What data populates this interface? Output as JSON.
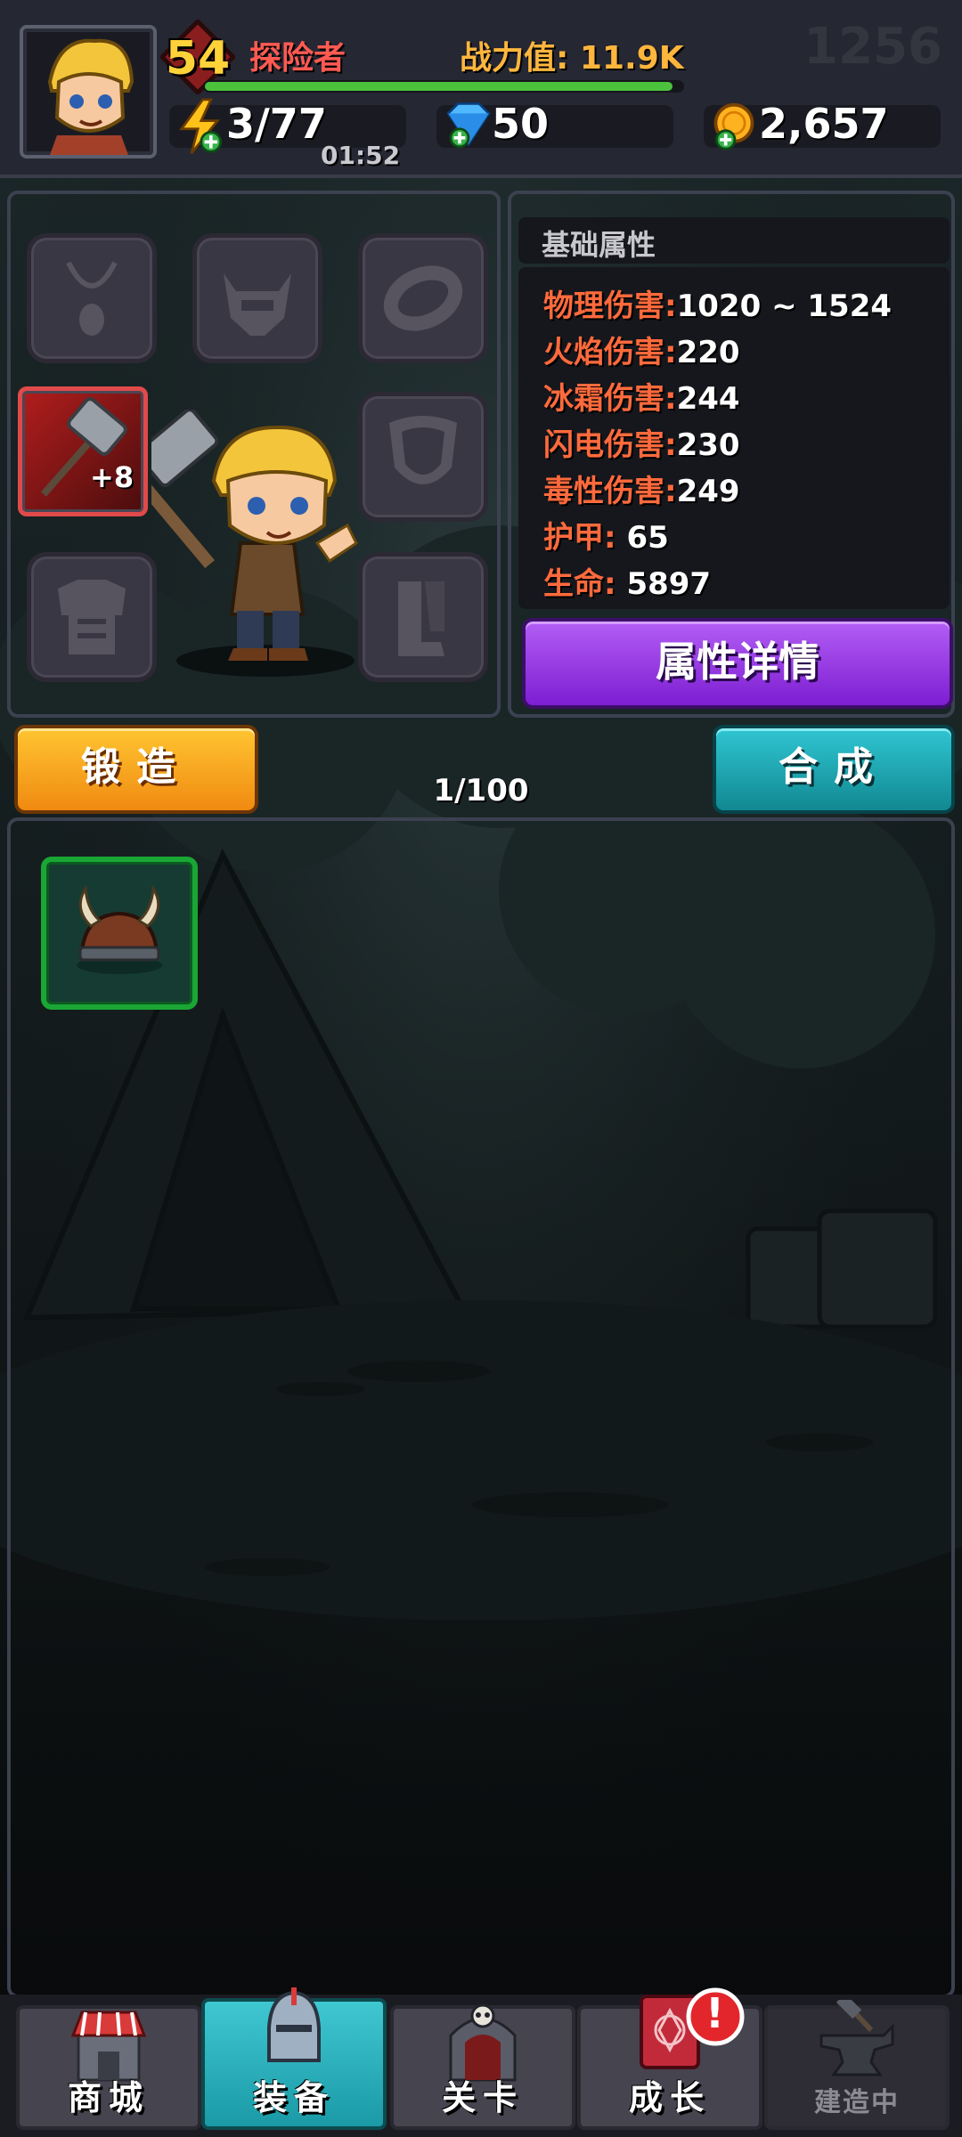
{
  "player": {
    "level": "54",
    "name": "探险者",
    "power_label": "战力值: 11.9K",
    "xp_fraction": 0.98
  },
  "resources": {
    "energy": "3/77",
    "energy_timer": "01:52",
    "gems": "50",
    "coins": "2,657"
  },
  "faded_number": "1256",
  "equipment": {
    "weapon_level": "+8",
    "slots": [
      "necklace-slot",
      "helmet-slot",
      "ring-slot",
      "weapon-slot",
      "shield-slot",
      "armor-slot",
      "boots-slot"
    ]
  },
  "stats": {
    "header": "基础属性",
    "rows": [
      {
        "label": "物理伤害:",
        "value": "1020 ~ 1524"
      },
      {
        "label": "火焰伤害:",
        "value": "220"
      },
      {
        "label": "冰霜伤害:",
        "value": "244"
      },
      {
        "label": "闪电伤害:",
        "value": "230"
      },
      {
        "label": "毒性伤害:",
        "value": "249"
      },
      {
        "label": "护甲: ",
        "value": "65"
      },
      {
        "label": "生命: ",
        "value": "5897"
      }
    ],
    "details_button": "属性详情"
  },
  "actions": {
    "forge": "锻造",
    "combine": "合成",
    "capacity": "1/100"
  },
  "inventory": {
    "items": [
      {
        "icon": "viking-helmet-icon",
        "rarity_color": "#1aa635"
      }
    ]
  },
  "nav": {
    "tabs": [
      {
        "label": "商城",
        "icon": "shop-icon"
      },
      {
        "label": "装备",
        "icon": "knight-helmet-icon",
        "active": true
      },
      {
        "label": "关卡",
        "icon": "dungeon-gate-icon"
      },
      {
        "label": "成长",
        "icon": "spellbook-icon",
        "alert": "!"
      },
      {
        "label": "建造中",
        "icon": "anvil-icon",
        "disabled": true
      }
    ]
  },
  "colors": {
    "accent_stat": "#ff6a3c",
    "power_text": "#ffb63d",
    "name_text": "#ff5a52",
    "level_text": "#ffd23a"
  }
}
